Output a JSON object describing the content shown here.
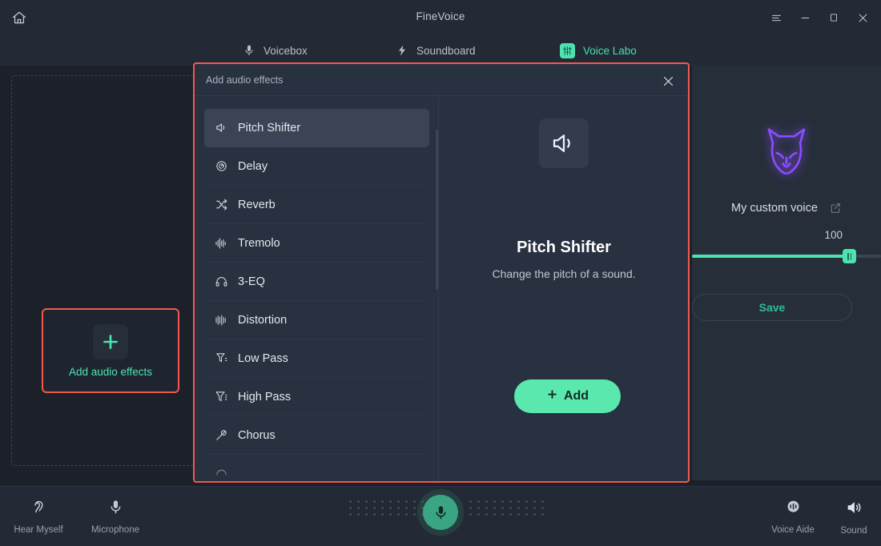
{
  "window": {
    "title": "FineVoice",
    "home_icon": "home-icon",
    "controls": [
      {
        "name": "menu-button",
        "icon": "hamburger-menu-icon"
      },
      {
        "name": "minimize-button",
        "icon": "minimize-icon"
      },
      {
        "name": "maximize-button",
        "icon": "maximize-icon"
      },
      {
        "name": "close-button",
        "icon": "close-icon"
      }
    ]
  },
  "nav": {
    "tabs": [
      {
        "label": "Voicebox",
        "icon": "microphone-icon",
        "active": false
      },
      {
        "label": "Soundboard",
        "icon": "lightning-bolt-icon",
        "active": false
      },
      {
        "label": "Voice Labo",
        "icon": "equalizer-sliders-icon",
        "active": true
      }
    ]
  },
  "workspace": {
    "add_card": {
      "label": "Add audio effects",
      "icon": "plus-icon"
    }
  },
  "voice_panel": {
    "avatar_icon": "neon-wolf-avatar-icon",
    "name": "My custom voice",
    "edit_icon": "edit-pencil-icon",
    "volume_value": "100",
    "save_label": "Save"
  },
  "modal": {
    "title": "Add audio effects",
    "close_icon": "close-icon",
    "effects": [
      {
        "label": "Pitch Shifter",
        "icon": "speaker-icon",
        "selected": true
      },
      {
        "label": "Delay",
        "icon": "delay-swirl-icon",
        "selected": false
      },
      {
        "label": "Reverb",
        "icon": "shuffle-icon",
        "selected": false
      },
      {
        "label": "Tremolo",
        "icon": "waveform-icon",
        "selected": false
      },
      {
        "label": "3-EQ",
        "icon": "headphones-icon",
        "selected": false
      },
      {
        "label": "Distortion",
        "icon": "bars-icon",
        "selected": false
      },
      {
        "label": "Low Pass",
        "icon": "filter-down-icon",
        "selected": false
      },
      {
        "label": "High Pass",
        "icon": "filter-up-icon",
        "selected": false
      },
      {
        "label": "Chorus",
        "icon": "mic-slash-icon",
        "selected": false
      }
    ],
    "detail": {
      "icon": "speaker-icon",
      "title": "Pitch Shifter",
      "description": "Change the pitch of a sound.",
      "add_label": "Add",
      "add_icon": "plus-icon"
    }
  },
  "bottombar": {
    "left_items": [
      {
        "label": "Hear Myself",
        "icon": "ear-icon"
      },
      {
        "label": "Microphone",
        "icon": "microphone-icon"
      }
    ],
    "right_items": [
      {
        "label": "Voice Aide",
        "icon": "voice-aide-icon"
      },
      {
        "label": "Sound",
        "icon": "speaker-volume-icon"
      }
    ],
    "mic_button_icon": "microphone-icon"
  },
  "colors": {
    "accent_green": "#4de3b0",
    "highlight_red": "#f05a4e",
    "avatar_purple": "#8a4dfd",
    "panel_bg": "#262e3a",
    "app_bg": "#1b2029"
  }
}
